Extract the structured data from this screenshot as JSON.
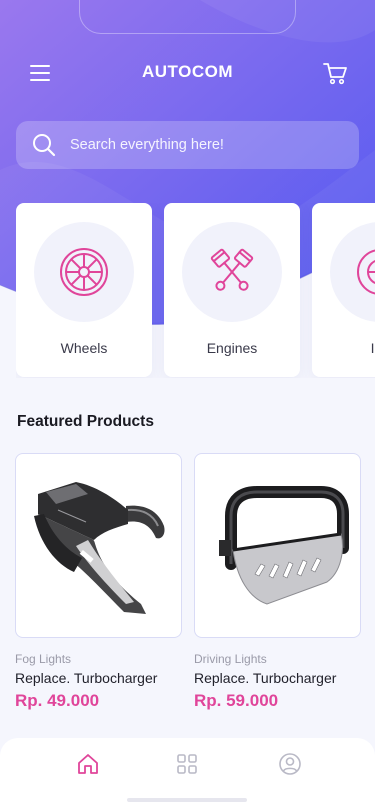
{
  "header": {
    "title": "AUTOCOM",
    "menu_icon": "hamburger-menu-icon",
    "cart_icon": "shopping-cart-icon"
  },
  "search": {
    "placeholder": "Search everything here!",
    "icon": "search-icon"
  },
  "categories": [
    {
      "label": "Wheels",
      "icon": "wheel-icon"
    },
    {
      "label": "Engines",
      "icon": "pistons-icon"
    },
    {
      "label": "Ins",
      "icon": "tire-icon"
    }
  ],
  "featured": {
    "title": "Featured Products",
    "products": [
      {
        "category": "Fog Lights",
        "name": "Replace. Turbocharger",
        "price": "Rp. 49.000"
      },
      {
        "category": "Driving Lights",
        "name": "Replace. Turbocharger",
        "price": "Rp. 59.000"
      }
    ]
  },
  "bottom_nav": [
    {
      "icon": "home-icon",
      "active": true
    },
    {
      "icon": "grid-icon",
      "active": false
    },
    {
      "icon": "profile-icon",
      "active": false
    }
  ],
  "colors": {
    "gradient_start": "#8c72f0",
    "gradient_end": "#5a5cf2",
    "accent": "#e0459a",
    "background": "#f5f6fd"
  }
}
